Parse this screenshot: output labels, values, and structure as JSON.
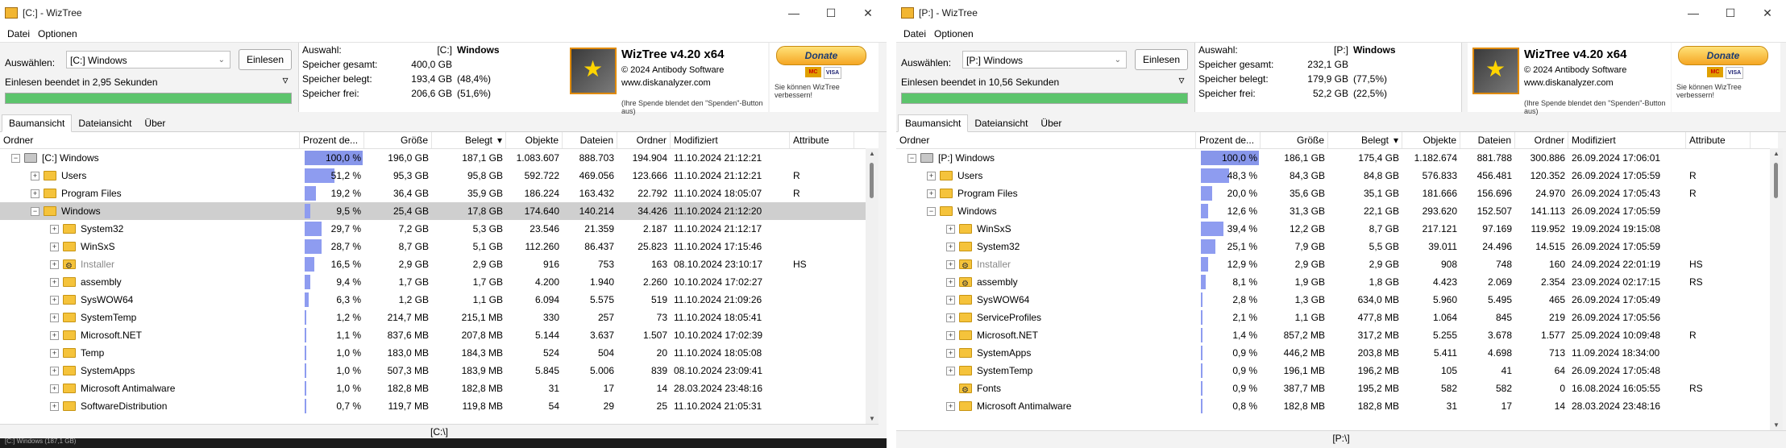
{
  "windows": [
    {
      "title": "[C:]  - WizTree",
      "menu": [
        "Datei",
        "Optionen"
      ],
      "select_label": "Auswählen:",
      "drive_value": "[C:] Windows",
      "scan_button": "Einlesen",
      "scan_status": "Einlesen beendet in 2,95 Sekunden",
      "stats": {
        "header_label": "Auswahl:",
        "drive": "[C:]",
        "drive_name": "Windows",
        "total_label": "Speicher gesamt:",
        "total": "400,0 GB",
        "used_label": "Speicher belegt:",
        "used": "193,4 GB",
        "used_pct": "(48,4%)",
        "free_label": "Speicher frei:",
        "free": "206,6 GB",
        "free_pct": "(51,6%)"
      },
      "logo": {
        "title": "WizTree v4.20 x64",
        "copyright": "© 2024 Antibody Software",
        "url": "www.diskanalyzer.com",
        "note": "(Ihre Spende blendet den \"Spenden\"-Button aus)"
      },
      "donate": {
        "label": "Donate",
        "note": "Sie können WizTree verbessern!",
        "mastercard": "MC",
        "visa": "VISA"
      },
      "tabs": [
        "Baumansicht",
        "Dateiansicht",
        "Über"
      ],
      "columns": [
        "Ordner",
        "Prozent de...",
        "Größe",
        "Belegt",
        "Objekte",
        "Dateien",
        "Ordner",
        "Modifiziert",
        "Attribute"
      ],
      "rows": [
        {
          "name": "[C:] Windows",
          "level": 0,
          "icon": "drive-icon",
          "pct": 100.0,
          "pct_text": "100,0 %",
          "size": "196,0 GB",
          "alloc": "187,1 GB",
          "items": "1.083.607",
          "files": "888.703",
          "folders": "194.904",
          "modified": "11.10.2024 21:12:21",
          "attr": "",
          "expander": "−"
        },
        {
          "name": "Users",
          "level": 1,
          "icon": "folder-icon",
          "pct": 51.2,
          "pct_text": "51,2 %",
          "size": "95,3 GB",
          "alloc": "95,8 GB",
          "items": "592.722",
          "files": "469.056",
          "folders": "123.666",
          "modified": "11.10.2024 21:12:21",
          "attr": "R",
          "expander": "+"
        },
        {
          "name": "Program Files",
          "level": 1,
          "icon": "folder-icon",
          "pct": 19.2,
          "pct_text": "19,2 %",
          "size": "36,4 GB",
          "alloc": "35,9 GB",
          "items": "186.224",
          "files": "163.432",
          "folders": "22.792",
          "modified": "11.10.2024 18:05:07",
          "attr": "R",
          "expander": "+"
        },
        {
          "name": "Windows",
          "level": 1,
          "icon": "folder-icon",
          "pct": 9.5,
          "pct_text": "9,5 %",
          "size": "25,4 GB",
          "alloc": "17,8 GB",
          "items": "174.640",
          "files": "140.214",
          "folders": "34.426",
          "modified": "11.10.2024 21:12:20",
          "attr": "",
          "expander": "−",
          "selected": true
        },
        {
          "name": "System32",
          "level": 2,
          "icon": "folder-icon",
          "pct": 29.7,
          "pct_text": "29,7 %",
          "size": "7,2 GB",
          "alloc": "5,3 GB",
          "items": "23.546",
          "files": "21.359",
          "folders": "2.187",
          "modified": "11.10.2024 21:12:17",
          "attr": "",
          "expander": "+"
        },
        {
          "name": "WinSxS",
          "level": 2,
          "icon": "folder-icon",
          "pct": 28.7,
          "pct_text": "28,7 %",
          "size": "8,7 GB",
          "alloc": "5,1 GB",
          "items": "112.260",
          "files": "86.437",
          "folders": "25.823",
          "modified": "11.10.2024 17:15:46",
          "attr": "",
          "expander": "+"
        },
        {
          "name": "Installer",
          "level": 2,
          "icon": "gear-folder-icon",
          "pct": 16.5,
          "pct_text": "16,5 %",
          "size": "2,9 GB",
          "alloc": "2,9 GB",
          "items": "916",
          "files": "753",
          "folders": "163",
          "modified": "08.10.2024 23:10:17",
          "attr": "HS",
          "expander": "+",
          "grey": true
        },
        {
          "name": "assembly",
          "level": 2,
          "icon": "folder-icon",
          "pct": 9.4,
          "pct_text": "9,4 %",
          "size": "1,7 GB",
          "alloc": "1,7 GB",
          "items": "4.200",
          "files": "1.940",
          "folders": "2.260",
          "modified": "10.10.2024 17:02:27",
          "attr": "",
          "expander": "+"
        },
        {
          "name": "SysWOW64",
          "level": 2,
          "icon": "folder-icon",
          "pct": 6.3,
          "pct_text": "6,3 %",
          "size": "1,2 GB",
          "alloc": "1,1 GB",
          "items": "6.094",
          "files": "5.575",
          "folders": "519",
          "modified": "11.10.2024 21:09:26",
          "attr": "",
          "expander": "+"
        },
        {
          "name": "SystemTemp",
          "level": 2,
          "icon": "folder-icon",
          "pct": 1.2,
          "pct_text": "1,2 %",
          "size": "214,7 MB",
          "alloc": "215,1 MB",
          "items": "330",
          "files": "257",
          "folders": "73",
          "modified": "11.10.2024 18:05:41",
          "attr": "",
          "expander": "+"
        },
        {
          "name": "Microsoft.NET",
          "level": 2,
          "icon": "folder-icon",
          "pct": 1.1,
          "pct_text": "1,1 %",
          "size": "837,6 MB",
          "alloc": "207,8 MB",
          "items": "5.144",
          "files": "3.637",
          "folders": "1.507",
          "modified": "10.10.2024 17:02:39",
          "attr": "",
          "expander": "+"
        },
        {
          "name": "Temp",
          "level": 2,
          "icon": "folder-icon",
          "pct": 1.0,
          "pct_text": "1,0 %",
          "size": "183,0 MB",
          "alloc": "184,3 MB",
          "items": "524",
          "files": "504",
          "folders": "20",
          "modified": "11.10.2024 18:05:08",
          "attr": "",
          "expander": "+"
        },
        {
          "name": "SystemApps",
          "level": 2,
          "icon": "folder-icon",
          "pct": 1.0,
          "pct_text": "1,0 %",
          "size": "507,3 MB",
          "alloc": "183,9 MB",
          "items": "5.845",
          "files": "5.006",
          "folders": "839",
          "modified": "08.10.2024 23:09:41",
          "attr": "",
          "expander": "+"
        },
        {
          "name": "Microsoft Antimalware",
          "level": 2,
          "icon": "folder-icon",
          "pct": 1.0,
          "pct_text": "1,0 %",
          "size": "182,8 MB",
          "alloc": "182,8 MB",
          "items": "31",
          "files": "17",
          "folders": "14",
          "modified": "28.03.2024 23:48:16",
          "attr": "",
          "expander": "+"
        },
        {
          "name": "SoftwareDistribution",
          "level": 2,
          "icon": "folder-icon",
          "pct": 0.7,
          "pct_text": "0,7 %",
          "size": "119,7 MB",
          "alloc": "119,8 MB",
          "items": "54",
          "files": "29",
          "folders": "25",
          "modified": "11.10.2024 21:05:31",
          "attr": "",
          "expander": "+"
        }
      ],
      "path": "[C:\\]",
      "treemap_label": "[C:] Windows (187,1 GB)"
    },
    {
      "title": "[P:]  - WizTree",
      "menu": [
        "Datei",
        "Optionen"
      ],
      "select_label": "Auswählen:",
      "drive_value": "[P:] Windows",
      "scan_button": "Einlesen",
      "scan_status": "Einlesen beendet in 10,56 Sekunden",
      "stats": {
        "header_label": "Auswahl:",
        "drive": "[P:]",
        "drive_name": "Windows",
        "total_label": "Speicher gesamt:",
        "total": "232,1 GB",
        "used_label": "Speicher belegt:",
        "used": "179,9 GB",
        "used_pct": "(77,5%)",
        "free_label": "Speicher frei:",
        "free": "52,2 GB",
        "free_pct": "(22,5%)"
      },
      "logo": {
        "title": "WizTree v4.20 x64",
        "copyright": "© 2024 Antibody Software",
        "url": "www.diskanalyzer.com",
        "note": "(Ihre Spende blendet den \"Spenden\"-Button aus)"
      },
      "donate": {
        "label": "Donate",
        "note": "Sie können WizTree verbessern!",
        "mastercard": "MC",
        "visa": "VISA"
      },
      "tabs": [
        "Baumansicht",
        "Dateiansicht",
        "Über"
      ],
      "columns": [
        "Ordner",
        "Prozent de...",
        "Größe",
        "Belegt",
        "Objekte",
        "Dateien",
        "Ordner",
        "Modifiziert",
        "Attribute"
      ],
      "rows": [
        {
          "name": "[P:] Windows",
          "level": 0,
          "icon": "drive-icon",
          "pct": 100.0,
          "pct_text": "100,0 %",
          "size": "186,1 GB",
          "alloc": "175,4 GB",
          "items": "1.182.674",
          "files": "881.788",
          "folders": "300.886",
          "modified": "26.09.2024 17:06:01",
          "attr": "",
          "expander": "−"
        },
        {
          "name": "Users",
          "level": 1,
          "icon": "folder-icon",
          "pct": 48.3,
          "pct_text": "48,3 %",
          "size": "84,3 GB",
          "alloc": "84,8 GB",
          "items": "576.833",
          "files": "456.481",
          "folders": "120.352",
          "modified": "26.09.2024 17:05:59",
          "attr": "R",
          "expander": "+"
        },
        {
          "name": "Program Files",
          "level": 1,
          "icon": "folder-icon",
          "pct": 20.0,
          "pct_text": "20,0 %",
          "size": "35,6 GB",
          "alloc": "35,1 GB",
          "items": "181.666",
          "files": "156.696",
          "folders": "24.970",
          "modified": "26.09.2024 17:05:43",
          "attr": "R",
          "expander": "+"
        },
        {
          "name": "Windows",
          "level": 1,
          "icon": "folder-icon",
          "pct": 12.6,
          "pct_text": "12,6 %",
          "size": "31,3 GB",
          "alloc": "22,1 GB",
          "items": "293.620",
          "files": "152.507",
          "folders": "141.113",
          "modified": "26.09.2024 17:05:59",
          "attr": "",
          "expander": "−"
        },
        {
          "name": "WinSxS",
          "level": 2,
          "icon": "folder-icon",
          "pct": 39.4,
          "pct_text": "39,4 %",
          "size": "12,2 GB",
          "alloc": "8,7 GB",
          "items": "217.121",
          "files": "97.169",
          "folders": "119.952",
          "modified": "19.09.2024 19:15:08",
          "attr": "",
          "expander": "+"
        },
        {
          "name": "System32",
          "level": 2,
          "icon": "folder-icon",
          "pct": 25.1,
          "pct_text": "25,1 %",
          "size": "7,9 GB",
          "alloc": "5,5 GB",
          "items": "39.011",
          "files": "24.496",
          "folders": "14.515",
          "modified": "26.09.2024 17:05:59",
          "attr": "",
          "expander": "+"
        },
        {
          "name": "Installer",
          "level": 2,
          "icon": "gear-folder-icon",
          "pct": 12.9,
          "pct_text": "12,9 %",
          "size": "2,9 GB",
          "alloc": "2,9 GB",
          "items": "908",
          "files": "748",
          "folders": "160",
          "modified": "24.09.2024 22:01:19",
          "attr": "HS",
          "expander": "+",
          "grey": true
        },
        {
          "name": "assembly",
          "level": 2,
          "icon": "gear-folder-icon",
          "pct": 8.1,
          "pct_text": "8,1 %",
          "size": "1,9 GB",
          "alloc": "1,8 GB",
          "items": "4.423",
          "files": "2.069",
          "folders": "2.354",
          "modified": "23.09.2024 02:17:15",
          "attr": "RS",
          "expander": "+"
        },
        {
          "name": "SysWOW64",
          "level": 2,
          "icon": "folder-icon",
          "pct": 2.8,
          "pct_text": "2,8 %",
          "size": "1,3 GB",
          "alloc": "634,0 MB",
          "items": "5.960",
          "files": "5.495",
          "folders": "465",
          "modified": "26.09.2024 17:05:49",
          "attr": "",
          "expander": "+"
        },
        {
          "name": "ServiceProfiles",
          "level": 2,
          "icon": "folder-icon",
          "pct": 2.1,
          "pct_text": "2,1 %",
          "size": "1,1 GB",
          "alloc": "477,8 MB",
          "items": "1.064",
          "files": "845",
          "folders": "219",
          "modified": "26.09.2024 17:05:56",
          "attr": "",
          "expander": "+"
        },
        {
          "name": "Microsoft.NET",
          "level": 2,
          "icon": "folder-icon",
          "pct": 1.4,
          "pct_text": "1,4 %",
          "size": "857,2 MB",
          "alloc": "317,2 MB",
          "items": "5.255",
          "files": "3.678",
          "folders": "1.577",
          "modified": "25.09.2024 10:09:48",
          "attr": "R",
          "expander": "+"
        },
        {
          "name": "SystemApps",
          "level": 2,
          "icon": "folder-icon",
          "pct": 0.9,
          "pct_text": "0,9 %",
          "size": "446,2 MB",
          "alloc": "203,8 MB",
          "items": "5.411",
          "files": "4.698",
          "folders": "713",
          "modified": "11.09.2024 18:34:00",
          "attr": "",
          "expander": "+"
        },
        {
          "name": "SystemTemp",
          "level": 2,
          "icon": "folder-icon",
          "pct": 0.9,
          "pct_text": "0,9 %",
          "size": "196,1 MB",
          "alloc": "196,2 MB",
          "items": "105",
          "files": "41",
          "folders": "64",
          "modified": "26.09.2024 17:05:48",
          "attr": "",
          "expander": "+"
        },
        {
          "name": "Fonts",
          "level": 2,
          "icon": "gear-folder-icon",
          "pct": 0.9,
          "pct_text": "0,9 %",
          "size": "387,7 MB",
          "alloc": "195,2 MB",
          "items": "582",
          "files": "582",
          "folders": "0",
          "modified": "16.08.2024 16:05:55",
          "attr": "RS",
          "expander": ""
        },
        {
          "name": "Microsoft Antimalware",
          "level": 2,
          "icon": "folder-icon",
          "pct": 0.8,
          "pct_text": "0,8 %",
          "size": "182,8 MB",
          "alloc": "182,8 MB",
          "items": "31",
          "files": "17",
          "folders": "14",
          "modified": "28.03.2024 23:48:16",
          "attr": "",
          "expander": "+"
        }
      ],
      "path": "[P:\\]",
      "treemap_label": ""
    }
  ]
}
